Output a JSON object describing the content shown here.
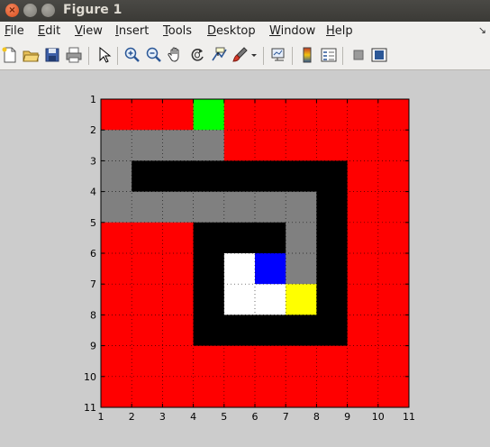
{
  "window": {
    "title": "Figure 1",
    "close_glyph": "×"
  },
  "menu": {
    "items": [
      {
        "label": "File",
        "u": "F",
        "rest": "ile"
      },
      {
        "label": "Edit",
        "u": "E",
        "rest": "dit"
      },
      {
        "label": "View",
        "u": "V",
        "rest": "iew"
      },
      {
        "label": "Insert",
        "u": "I",
        "rest": "nsert"
      },
      {
        "label": "Tools",
        "u": "T",
        "rest": "ools"
      },
      {
        "label": "Desktop",
        "u": "D",
        "rest": "esktop"
      },
      {
        "label": "Window",
        "u": "W",
        "rest": "indow"
      },
      {
        "label": "Help",
        "u": "H",
        "rest": "elp"
      }
    ],
    "overflow_glyph": "↘"
  },
  "toolbar": {
    "icons": [
      "new-figure-icon",
      "open-file-icon",
      "save-icon",
      "print-icon",
      "select-arrow-icon",
      "zoom-in-icon",
      "zoom-out-icon",
      "pan-hand-icon",
      "rotate-3d-icon",
      "data-cursor-icon",
      "brush-icon",
      "brush-dropdown-icon",
      "link-plot-icon",
      "colorbar-icon",
      "legend-icon",
      "hide-plot-tools-icon",
      "show-plot-tools-icon"
    ]
  },
  "chart_data": {
    "type": "heatmap",
    "title": "",
    "xlabel": "",
    "ylabel": "",
    "xlim": [
      1,
      11
    ],
    "ylim": [
      1,
      11
    ],
    "y_direction": "reversed",
    "xticks": [
      "1",
      "2",
      "3",
      "4",
      "5",
      "6",
      "7",
      "8",
      "9",
      "10",
      "11"
    ],
    "yticks": [
      "1",
      "2",
      "3",
      "4",
      "5",
      "6",
      "7",
      "8",
      "9",
      "10",
      "11"
    ],
    "grid": "dotted",
    "colors": {
      "R": "#ff0000",
      "G": "#808080",
      "K": "#000000",
      "W": "#ffffff",
      "B": "#0000ff",
      "Y": "#ffff00",
      "L": "#00ff00"
    },
    "cells": [
      [
        "R",
        "R",
        "R",
        "L",
        "R",
        "R",
        "R",
        "R",
        "R",
        "R"
      ],
      [
        "G",
        "G",
        "G",
        "G",
        "R",
        "R",
        "R",
        "R",
        "R",
        "R"
      ],
      [
        "G",
        "K",
        "K",
        "K",
        "K",
        "K",
        "K",
        "K",
        "R",
        "R"
      ],
      [
        "G",
        "G",
        "G",
        "G",
        "G",
        "G",
        "G",
        "K",
        "R",
        "R"
      ],
      [
        "R",
        "R",
        "R",
        "K",
        "K",
        "K",
        "G",
        "K",
        "R",
        "R"
      ],
      [
        "R",
        "R",
        "R",
        "K",
        "W",
        "B",
        "G",
        "K",
        "R",
        "R"
      ],
      [
        "R",
        "R",
        "R",
        "K",
        "W",
        "W",
        "Y",
        "K",
        "R",
        "R"
      ],
      [
        "R",
        "R",
        "R",
        "K",
        "K",
        "K",
        "K",
        "K",
        "R",
        "R"
      ],
      [
        "R",
        "R",
        "R",
        "R",
        "R",
        "R",
        "R",
        "R",
        "R",
        "R"
      ],
      [
        "R",
        "R",
        "R",
        "R",
        "R",
        "R",
        "R",
        "R",
        "R",
        "R"
      ]
    ]
  }
}
